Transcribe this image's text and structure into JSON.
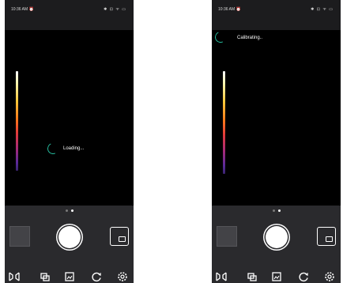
{
  "screens": [
    {
      "id": "loading",
      "status_bar": {
        "time": "10:36 AM ⏰",
        "icons": "✱ ⊡ ᯤ ▭"
      },
      "status_message": "Loading...",
      "page_dots": {
        "count": 2,
        "active": 1
      }
    },
    {
      "id": "calibrating",
      "status_bar": {
        "time": "10:36 AM ⏰",
        "icons": "✱ ⊡ ᯤ ▭"
      },
      "status_message": "Calibrating..",
      "page_dots": {
        "count": 2,
        "active": 1
      }
    }
  ],
  "toolbar_icons": [
    "dual-image-icon",
    "layers-icon",
    "image-edit-icon",
    "palette-cycle-icon",
    "settings-icon"
  ],
  "colors": {
    "accent": "#25b89a",
    "control_bg": "#2a2a2d",
    "viewport_bg": "#000000"
  }
}
